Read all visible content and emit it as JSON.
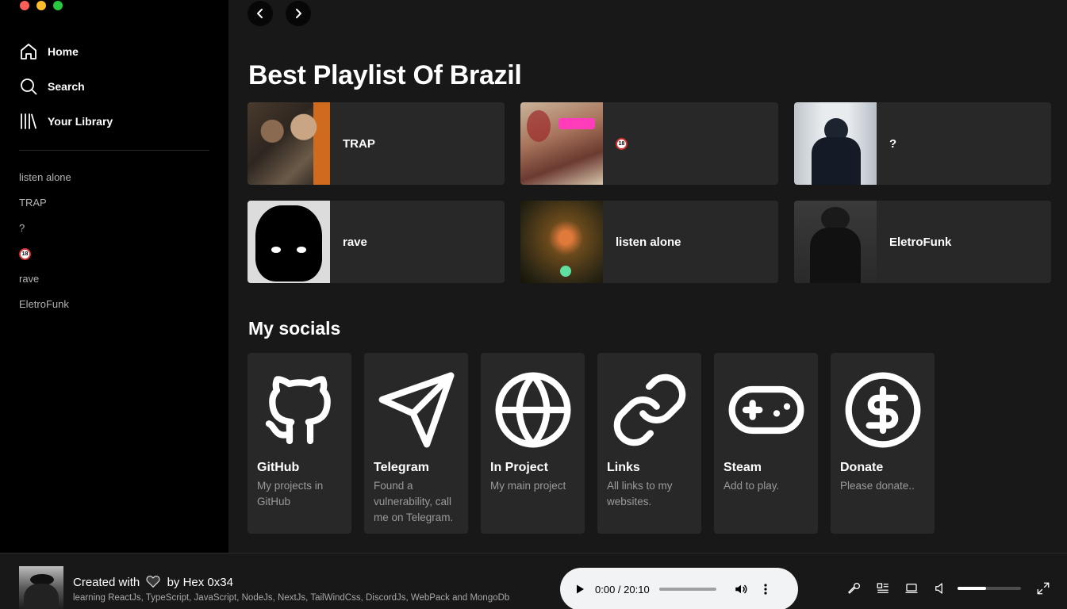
{
  "window": {
    "colors": [
      "#ff5f56",
      "#ffbd2e",
      "#27c93f"
    ]
  },
  "sidebar": {
    "nav": [
      {
        "label": "Home",
        "icon": "home-icon"
      },
      {
        "label": "Search",
        "icon": "search-icon"
      },
      {
        "label": "Your Library",
        "icon": "library-icon"
      }
    ],
    "playlists": [
      "listen alone",
      "TRAP",
      "?",
      "",
      "rave",
      "EletroFunk"
    ],
    "playlist_badge": "18"
  },
  "main": {
    "title": "Best Playlist Of Brazil",
    "cards": [
      {
        "label": "TRAP"
      },
      {
        "label": ""
      },
      {
        "label": "?"
      },
      {
        "label": "rave"
      },
      {
        "label": "listen alone"
      },
      {
        "label": "EletroFunk"
      }
    ],
    "card_badge": "18",
    "socials_title": "My socials",
    "socials": [
      {
        "title": "GitHub",
        "desc": "My projects in GitHub",
        "icon": "github-icon"
      },
      {
        "title": "Telegram",
        "desc": "Found a vulnerability, call me on Telegram.",
        "icon": "telegram-icon"
      },
      {
        "title": "In Project",
        "desc": "My main project",
        "icon": "globe-icon"
      },
      {
        "title": "Links",
        "desc": "All links to my websites.",
        "icon": "link-icon"
      },
      {
        "title": "Steam",
        "desc": "Add to play.",
        "icon": "gamepad-icon"
      },
      {
        "title": "Donate",
        "desc": "Please donate..",
        "icon": "dollar-icon"
      }
    ]
  },
  "player": {
    "title_prefix": "Created with",
    "title_suffix": "by Hex 0x34",
    "subtitle": "learning ReactJs, TypeScript, JavaScript, NodeJs, NextJs, TailWindCss, DiscordJs, WebPack and MongoDb",
    "time": "0:00 / 20:10",
    "progress": 0.0,
    "volume": 0.45
  },
  "accent": "#1db954"
}
